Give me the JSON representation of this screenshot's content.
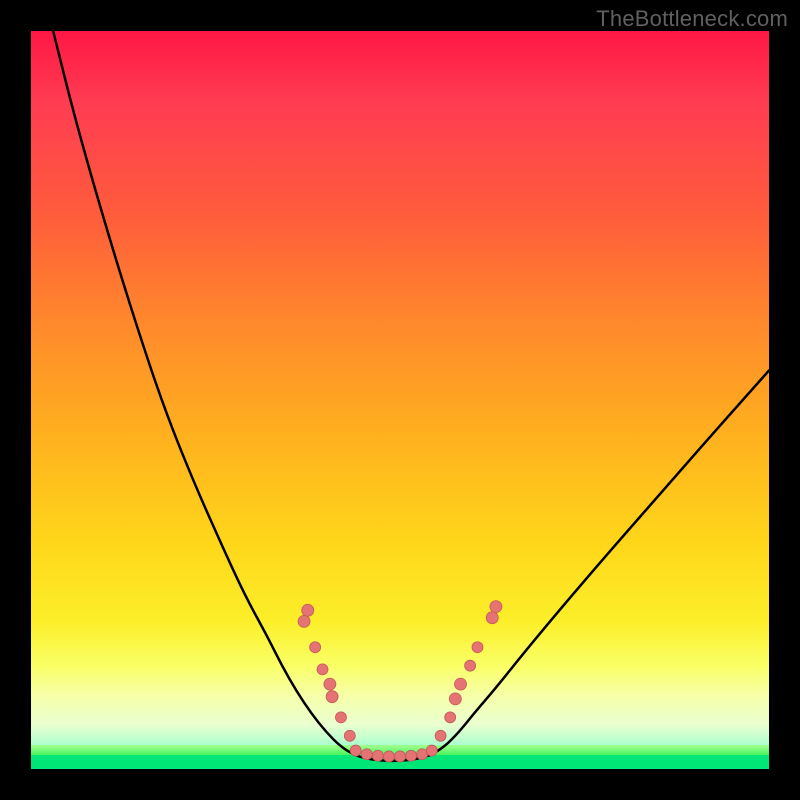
{
  "watermark": "TheBottleneck.com",
  "colors": {
    "frame": "#000000",
    "gradient_top": "#ff1744",
    "gradient_mid": "#ffd81a",
    "gradient_bottom": "#00c853",
    "curve": "#000000",
    "dot_fill": "#e57373",
    "dot_stroke": "#c25a5a"
  },
  "chart_data": {
    "type": "line",
    "title": "",
    "xlabel": "",
    "ylabel": "",
    "xlim": [
      0,
      100
    ],
    "ylim": [
      0,
      100
    ],
    "grid": false,
    "legend": null,
    "series": [
      {
        "name": "left-curve",
        "x": [
          3,
          6,
          10,
          14,
          18,
          22,
          26,
          29,
          32,
          34,
          36,
          38,
          40,
          42,
          44
        ],
        "y": [
          100,
          88,
          74,
          61,
          49,
          39,
          30,
          23.5,
          18,
          14,
          10.5,
          7.5,
          5,
          3,
          1.8
        ]
      },
      {
        "name": "flat-minimum",
        "x": [
          44,
          46,
          48,
          50,
          52,
          54
        ],
        "y": [
          1.8,
          1.3,
          1.1,
          1.1,
          1.3,
          1.8
        ]
      },
      {
        "name": "right-curve",
        "x": [
          54,
          56,
          58,
          60,
          63,
          67,
          72,
          78,
          85,
          92,
          100
        ],
        "y": [
          1.8,
          3,
          5,
          7.5,
          11,
          16,
          22,
          29,
          37,
          45,
          54
        ]
      }
    ],
    "dots_left": [
      {
        "x": 37.5,
        "y": 21.5,
        "r": 6
      },
      {
        "x": 37.0,
        "y": 20.0,
        "r": 6
      },
      {
        "x": 38.5,
        "y": 16.5,
        "r": 5.5
      },
      {
        "x": 39.5,
        "y": 13.5,
        "r": 5.5
      },
      {
        "x": 40.5,
        "y": 11.5,
        "r": 6
      },
      {
        "x": 40.8,
        "y": 9.8,
        "r": 6
      },
      {
        "x": 42.0,
        "y": 7.0,
        "r": 5.5
      },
      {
        "x": 43.2,
        "y": 4.5,
        "r": 5.5
      }
    ],
    "dots_bottom": [
      {
        "x": 44.0,
        "y": 2.5,
        "r": 5.5
      },
      {
        "x": 45.5,
        "y": 2.0,
        "r": 5.5
      },
      {
        "x": 47.0,
        "y": 1.8,
        "r": 5.5
      },
      {
        "x": 48.5,
        "y": 1.7,
        "r": 5.5
      },
      {
        "x": 50.0,
        "y": 1.7,
        "r": 5.5
      },
      {
        "x": 51.5,
        "y": 1.8,
        "r": 5.5
      },
      {
        "x": 53.0,
        "y": 2.0,
        "r": 5.5
      },
      {
        "x": 54.3,
        "y": 2.5,
        "r": 5.5
      }
    ],
    "dots_right": [
      {
        "x": 55.5,
        "y": 4.5,
        "r": 5.5
      },
      {
        "x": 56.8,
        "y": 7.0,
        "r": 5.5
      },
      {
        "x": 57.5,
        "y": 9.5,
        "r": 6
      },
      {
        "x": 58.2,
        "y": 11.5,
        "r": 6
      },
      {
        "x": 59.5,
        "y": 14.0,
        "r": 5.5
      },
      {
        "x": 60.5,
        "y": 16.5,
        "r": 5.5
      },
      {
        "x": 62.5,
        "y": 20.5,
        "r": 6
      },
      {
        "x": 63.0,
        "y": 22.0,
        "r": 6
      }
    ],
    "annotations": []
  }
}
